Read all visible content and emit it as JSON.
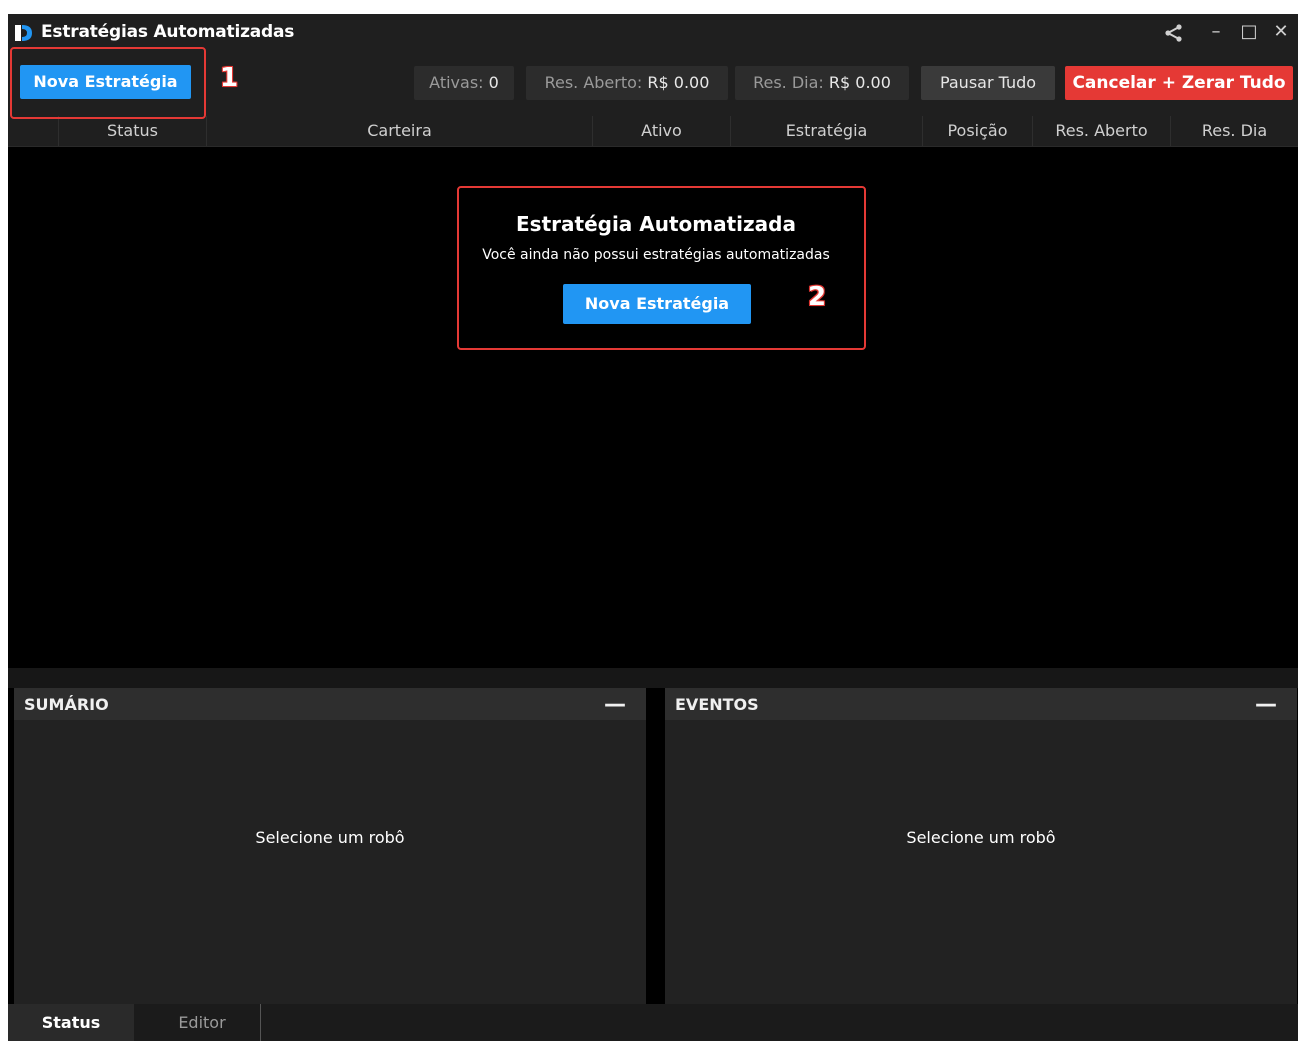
{
  "window": {
    "title": "Estratégias Automatizadas",
    "share_icon": "share-icon",
    "minimize_glyph": "–",
    "maximize_glyph": "□",
    "close_glyph": "✕"
  },
  "toolbar": {
    "new_strategy_label": "Nova Estratégia",
    "active_label": "Ativas:",
    "active_value": "0",
    "open_result_label": "Res. Aberto:",
    "open_result_value": "R$ 0.00",
    "day_result_label": "Res. Dia:",
    "day_result_value": "R$ 0.00",
    "pause_all_label": "Pausar Tudo",
    "cancel_all_label": "Cancelar + Zerar Tudo"
  },
  "annotations": {
    "marker_1": "1",
    "marker_2": "2"
  },
  "table": {
    "columns": [
      "Status",
      "Carteira",
      "Ativo",
      "Estratégia",
      "Posição",
      "Res. Aberto",
      "Res. Dia"
    ]
  },
  "empty_state": {
    "title": "Estratégia Automatizada",
    "subtitle": "Você ainda não possui estratégias automatizadas",
    "button_label": "Nova Estratégia"
  },
  "panels": {
    "summary": {
      "title": "SUMÁRIO",
      "placeholder": "Selecione um robô"
    },
    "events": {
      "title": "EVENTOS",
      "placeholder": "Selecione um robô"
    }
  },
  "tabs": [
    {
      "label": "Status",
      "active": true
    },
    {
      "label": "Editor",
      "active": false
    }
  ],
  "colors": {
    "accent_blue": "#2196f3",
    "danger_red": "#e53935",
    "background": "#000000"
  }
}
